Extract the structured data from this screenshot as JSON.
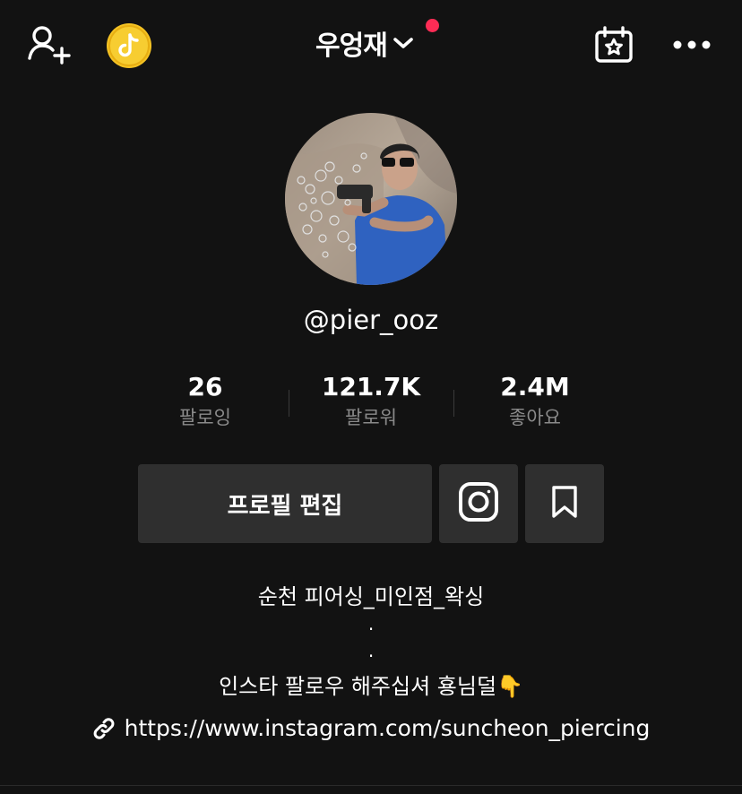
{
  "header": {
    "title": "우엉재",
    "notification_dot_color": "#fe2c55",
    "icons": [
      "add-friend-icon",
      "tiktok-coin-icon",
      "chevron-down-icon",
      "calendar-star-icon",
      "more-icon"
    ]
  },
  "profile": {
    "username": "@pier_ooz",
    "avatar_icon": "avatar-photo"
  },
  "stats": [
    {
      "value": "26",
      "label": "팔로잉"
    },
    {
      "value": "121.7K",
      "label": "팔로워"
    },
    {
      "value": "2.4M",
      "label": "좋아요"
    }
  ],
  "actions": {
    "edit_label": "프로필 편집",
    "instagram_icon": "instagram-icon",
    "bookmark_icon": "bookmark-icon"
  },
  "bio": {
    "line1": "순천 피어싱_미인점_왁싱",
    "dot1": ".",
    "dot2": ".",
    "line2": "인스타 팔로우 해주십셔 횽님덜👇",
    "link": "https://www.instagram.com/suncheon_piercing"
  },
  "colors": {
    "background": "#121212",
    "button_bg": "#2f2f2f",
    "secondary_text": "#8a8a8a",
    "coin": "#f5c324"
  }
}
